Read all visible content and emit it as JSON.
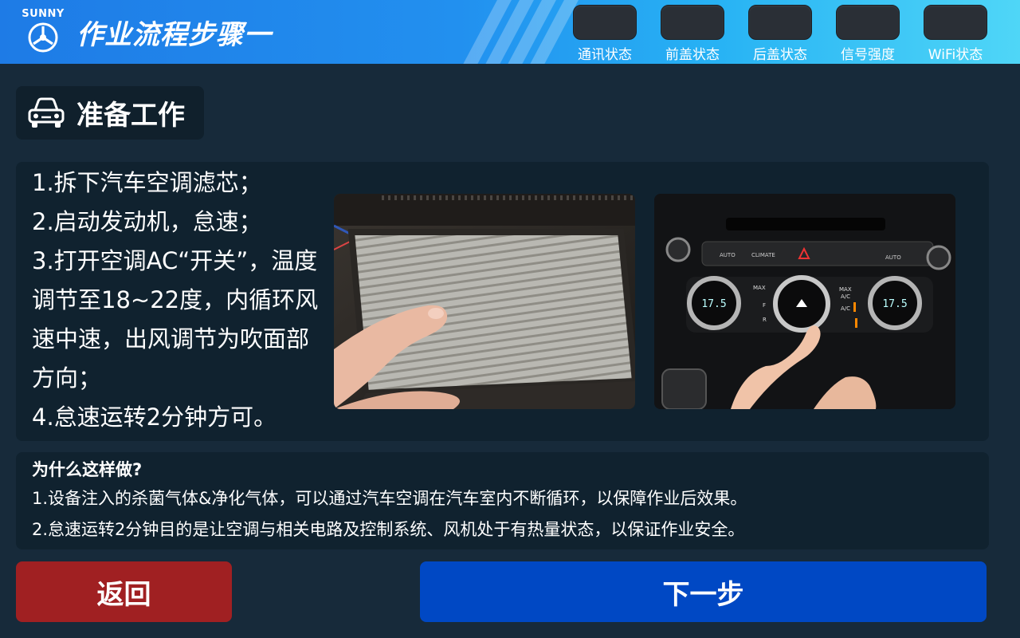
{
  "header": {
    "logo_text": "SUNNY",
    "title": "作业流程步骤一",
    "status_items": [
      {
        "label": "通讯状态"
      },
      {
        "label": "前盖状态"
      },
      {
        "label": "后盖状态"
      },
      {
        "label": "信号强度"
      },
      {
        "label": "WiFi状态"
      }
    ]
  },
  "section": {
    "icon": "car-icon",
    "title": "准备工作"
  },
  "steps": [
    "1.拆下汽车空调滤芯；",
    "2.启动发动机，怠速；",
    "3.打开空调AC“开关”，温度调节至18~22度，内循环风速中速，出风调节为吹面部方向；",
    "4.怠速运转2分钟方可。"
  ],
  "photos": {
    "filter_panel": {
      "icon": "air-filter-photo"
    },
    "ac_panel": {
      "icon": "ac-control-photo",
      "left_display": "17.5",
      "right_display": "17.5",
      "button_labels": [
        "AUTO",
        "CLIMATE",
        "AUTO",
        "MAX",
        "MAX",
        "A/C",
        "A/C",
        "F",
        "R"
      ]
    }
  },
  "why": {
    "title": "为什么这样做?",
    "lines": [
      "1.设备注入的杀菌气体&净化气体，可以通过汽车空调在汽车室内不断循环，以保障作业后效果。",
      "2.怠速运转2分钟目的是让空调与相关电路及控制系统、风机处于有热量状态，以保证作业安全。"
    ]
  },
  "buttons": {
    "back": "返回",
    "next": "下一步"
  },
  "colors": {
    "background": "#172a3a",
    "panel": "#10222f",
    "back_button": "#a02022",
    "next_button": "#0048c4",
    "header_start": "#1e7be6",
    "header_end": "#4fd6f7",
    "status_indicator": "#2a2f36"
  }
}
